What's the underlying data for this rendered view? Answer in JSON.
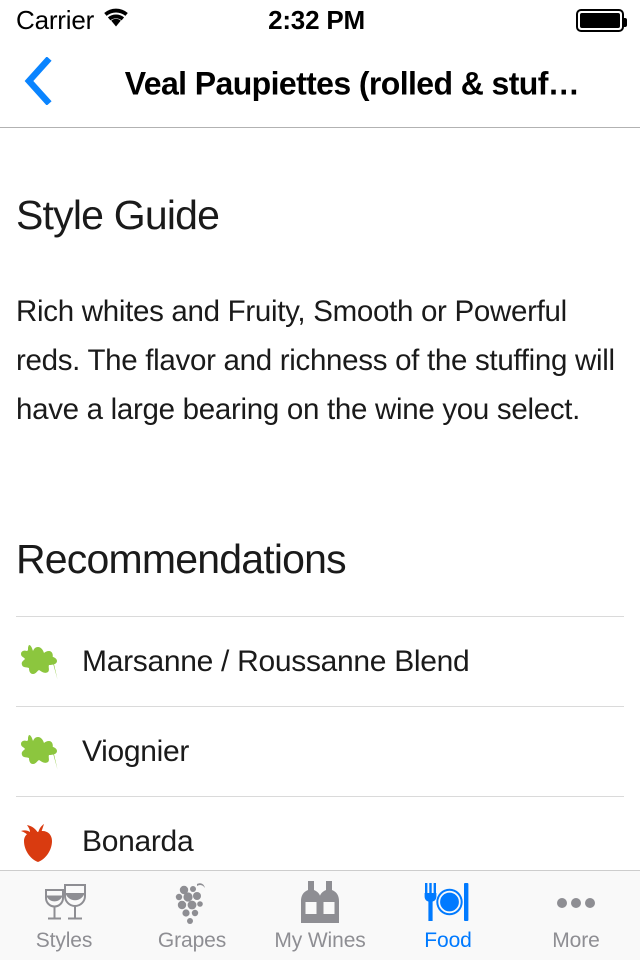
{
  "status_bar": {
    "carrier": "Carrier",
    "wifi_icon": "wifi-icon",
    "time": "2:32 PM",
    "battery_icon": "battery-full-icon",
    "battery_level": 100
  },
  "nav_bar": {
    "back_icon": "chevron-left-icon",
    "title": "Veal Paupiettes (rolled & stuf…",
    "accent_color": "#007aff"
  },
  "main": {
    "style_guide": {
      "heading": "Style Guide",
      "body": "Rich whites and Fruity, Smooth or Powerful reds. The flavor and richness of the stuffing will have a large bearing on the wine you select."
    },
    "recommendations": {
      "heading": "Recommendations",
      "items": [
        {
          "label": "Marsanne / Roussanne Blend",
          "icon": "green-leaf-icon",
          "icon_color": "#8cc63e"
        },
        {
          "label": "Viognier",
          "icon": "green-leaf-icon",
          "icon_color": "#8cc63e"
        },
        {
          "label": "Bonarda",
          "icon": "red-strawberry-icon",
          "icon_color": "#d93b10"
        }
      ]
    }
  },
  "tab_bar": {
    "active_color": "#007aff",
    "inactive_color": "#8e8e93",
    "items": [
      {
        "label": "Styles",
        "icon": "wine-glasses-icon",
        "active": false
      },
      {
        "label": "Grapes",
        "icon": "grape-cluster-icon",
        "active": false
      },
      {
        "label": "My Wines",
        "icon": "wine-bottles-icon",
        "active": false
      },
      {
        "label": "Food",
        "icon": "fork-plate-knife-icon",
        "active": true
      },
      {
        "label": "More",
        "icon": "ellipsis-icon",
        "active": false
      }
    ]
  }
}
